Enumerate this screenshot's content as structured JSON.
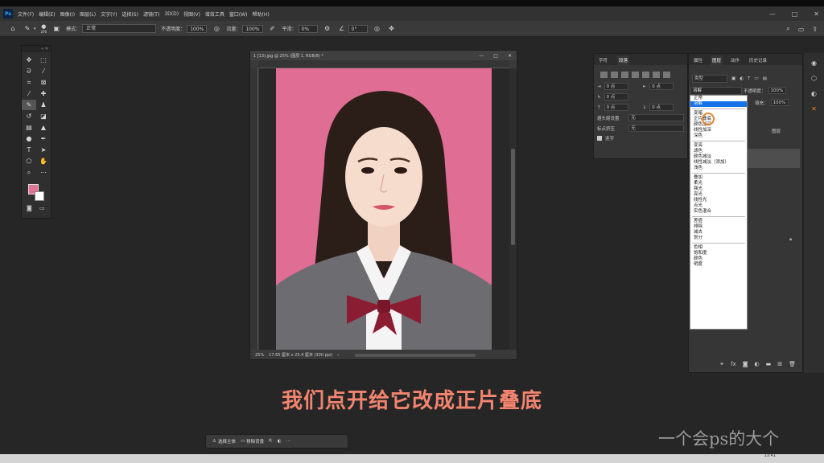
{
  "menubar": {
    "logo": "Ps",
    "items": [
      "文件(F)",
      "编辑(E)",
      "图像(I)",
      "图层(L)",
      "文字(Y)",
      "选择(S)",
      "滤镜(T)",
      "3D(D)",
      "视图(V)",
      "增效工具",
      "窗口(W)",
      "帮助(H)"
    ]
  },
  "window_controls": {
    "minimize": "—",
    "restore": "□",
    "close": "✕"
  },
  "options_bar": {
    "brush_size": "200",
    "mode_label": "模式：",
    "mode_value": "正常",
    "opacity_label": "不透明度：",
    "opacity_value": "100%",
    "flow_label": "流量：",
    "flow_value": "100%",
    "smooth_label": "平滑：",
    "smooth_value": "0%",
    "angle_value": "0°"
  },
  "document": {
    "title": "1  [13).jpg @ 25% (图层 1, RGB/8) *",
    "zoom": "25%",
    "size_info": "17.65 厘米 x 25.4 厘米 (300 ppi)"
  },
  "char_panel": {
    "tabs": [
      "字符",
      "段落"
    ],
    "active_tab": "段落",
    "indent_left": "0 点",
    "indent_right": "0 点",
    "indent_first": "0 点",
    "space_before": "0 点",
    "space_after": "0 点",
    "kinsoku_label": "避头尾设置",
    "kinsoku_value": "无",
    "mojikumi_label": "标点挤压",
    "mojikumi_value": "无",
    "hyphen_label": "连字"
  },
  "layers_panel": {
    "tabs": [
      "属性",
      "图层",
      "动作",
      "历史记录"
    ],
    "active_tab": "图层",
    "kind_filter": "类型",
    "blend_current": "溶解",
    "opacity_label": "不透明度：",
    "opacity_value": "100%",
    "fill_label": "填充：",
    "fill_value": "100%",
    "layer_name": "图层"
  },
  "blend_dropdown": {
    "groups": [
      [
        "正常",
        "溶解"
      ],
      [
        "变暗",
        "正片叠底",
        "颜色加深",
        "线性加深",
        "深色"
      ],
      [
        "变亮",
        "滤色",
        "颜色减淡",
        "线性减淡（添加）",
        "浅色"
      ],
      [
        "叠加",
        "柔光",
        "强光",
        "亮光",
        "线性光",
        "点光",
        "实色混合"
      ],
      [
        "差值",
        "排除",
        "减去",
        "划分"
      ],
      [
        "色相",
        "饱和度",
        "颜色",
        "明度"
      ]
    ],
    "highlighted": "溶解"
  },
  "subtitle": "我们点开给它改成正片叠底",
  "context_bar": {
    "select_subject": "选择主体",
    "remove_bg": "移除背景"
  },
  "watermark": "一个会ps的大个",
  "clock": "13:41",
  "colors": {
    "foreground": "#e17394",
    "background": "#ffffff",
    "canvas_bg": "#e06d93",
    "subtitle": "#f2846f"
  }
}
